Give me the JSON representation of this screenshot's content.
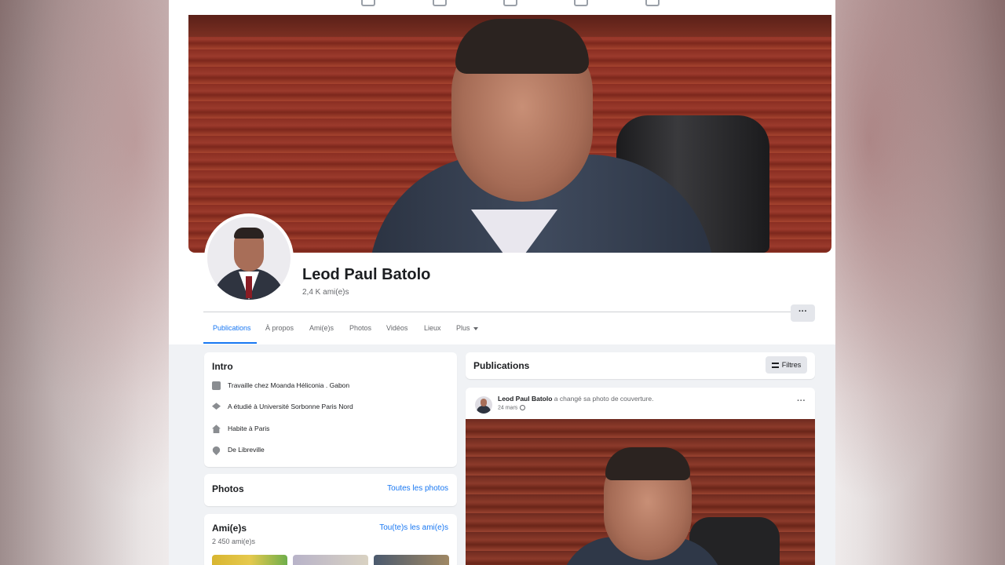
{
  "topnav": {
    "icons": [
      "home-icon",
      "flag-icon",
      "marketplace-icon",
      "megaphone-icon",
      "gaming-icon"
    ]
  },
  "profile": {
    "name": "Leod Paul Batolo",
    "friends_count": "2,4 K ami(e)s"
  },
  "tabs": [
    {
      "label": "Publications",
      "active": true
    },
    {
      "label": "À propos"
    },
    {
      "label": "Ami(e)s"
    },
    {
      "label": "Photos"
    },
    {
      "label": "Vidéos"
    },
    {
      "label": "Lieux"
    },
    {
      "label": "Plus"
    }
  ],
  "more_button": "···",
  "intro": {
    "title": "Intro",
    "items": [
      {
        "icon": "briefcase-icon",
        "text": "Travaille chez Moanda Héliconia . Gabon"
      },
      {
        "icon": "graduation-cap-icon",
        "text": "A étudié à Université Sorbonne Paris Nord"
      },
      {
        "icon": "home-icon",
        "text": "Habite à Paris"
      },
      {
        "icon": "location-pin-icon",
        "text": "De Libreville"
      }
    ]
  },
  "photos": {
    "title": "Photos",
    "link": "Toutes les photos"
  },
  "friends": {
    "title": "Ami(e)s",
    "link": "Tou(te)s les ami(e)s",
    "count": "2 450 ami(e)s"
  },
  "publications": {
    "title": "Publications",
    "filters": "Filtres"
  },
  "post": {
    "author": "Leod Paul Batolo",
    "action": "a changé sa photo de couverture.",
    "time": "24 mars",
    "more": "···"
  },
  "colors": {
    "accent": "#1877f2",
    "background": "#f0f2f5"
  }
}
